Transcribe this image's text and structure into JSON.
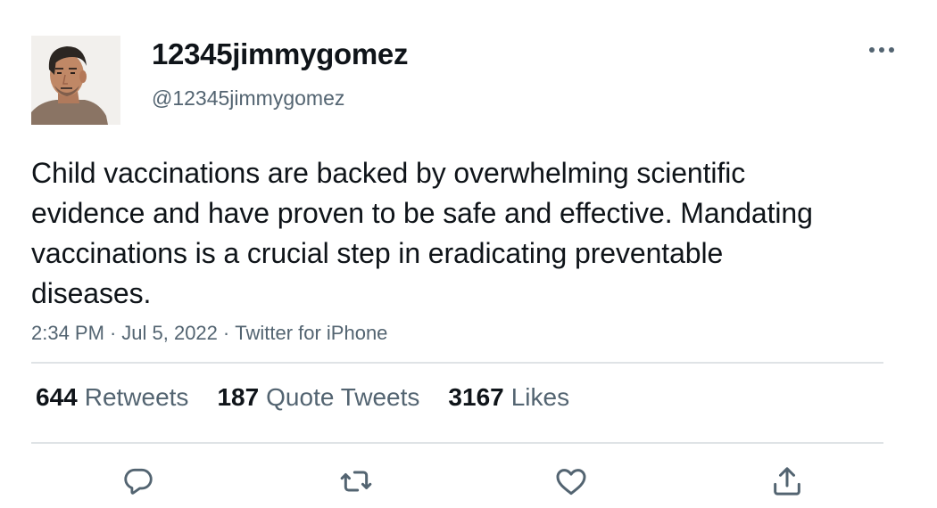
{
  "user": {
    "display_name": "12345jimmygomez",
    "handle": "@12345jimmygomez"
  },
  "tweet": {
    "text": "Child vaccinations are backed by overwhelming scientific evidence and have proven to be safe and effective. Mandating vaccinations is a crucial step in eradicating preventable diseases.",
    "time": "2:34 PM",
    "date": "Jul 5, 2022",
    "source": "Twitter for iPhone",
    "separator": "·"
  },
  "stats": {
    "retweets_count": "644",
    "retweets_label": "Retweets",
    "quotes_count": "187",
    "quotes_label": "Quote Tweets",
    "likes_count": "3167",
    "likes_label": "Likes"
  },
  "icons": {
    "more": "more-horizontal-icon",
    "reply": "reply-icon",
    "retweet": "retweet-icon",
    "like": "heart-icon",
    "share": "share-icon"
  },
  "colors": {
    "text": "#0f1419",
    "secondary": "#536471",
    "divider": "#dfe3e6",
    "icon": "#536471"
  }
}
